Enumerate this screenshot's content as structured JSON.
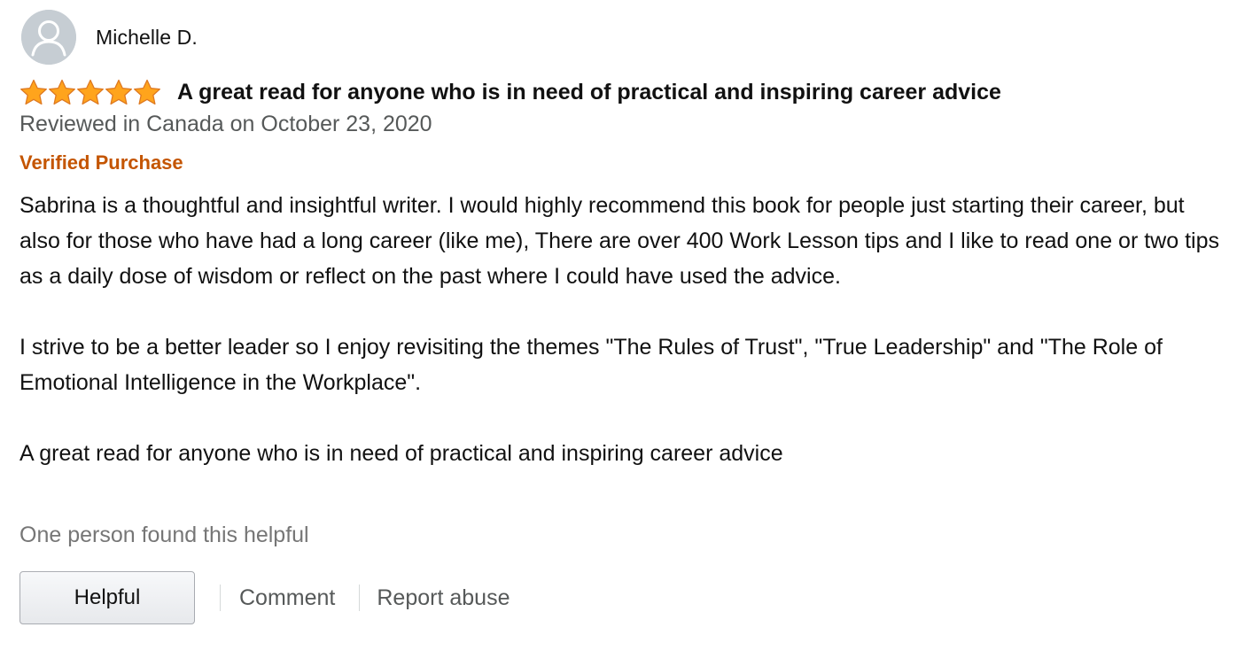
{
  "reviewer": {
    "name": "Michelle D.",
    "avatar_icon": "user-silhouette-icon"
  },
  "review": {
    "rating": 5,
    "rating_max": 5,
    "star_color": "#ffa41c",
    "title": "A great read for anyone who is in need of practical and inspiring career advice",
    "date_line": "Reviewed in Canada on October 23, 2020",
    "verified_label": "Verified Purchase",
    "verified_color": "#c45500",
    "paragraphs": [
      "Sabrina is a thoughtful and insightful writer. I would highly recommend this book for people just starting their career, but also for those who have had a long career (like me), There are over 400 Work Lesson tips and I like to read one or two tips as a daily dose of wisdom or reflect on the past where I could have used the advice.",
      "I strive to be a better leader so I enjoy revisiting the themes \"The Rules of Trust\", \"True Leadership\" and \"The Role of Emotional Intelligence in the Workplace\".",
      "A great read for anyone who is in need of practical and inspiring career advice"
    ],
    "helpful_count_text": "One person found this helpful"
  },
  "actions": {
    "helpful_label": "Helpful",
    "comment_label": "Comment",
    "report_label": "Report abuse"
  }
}
